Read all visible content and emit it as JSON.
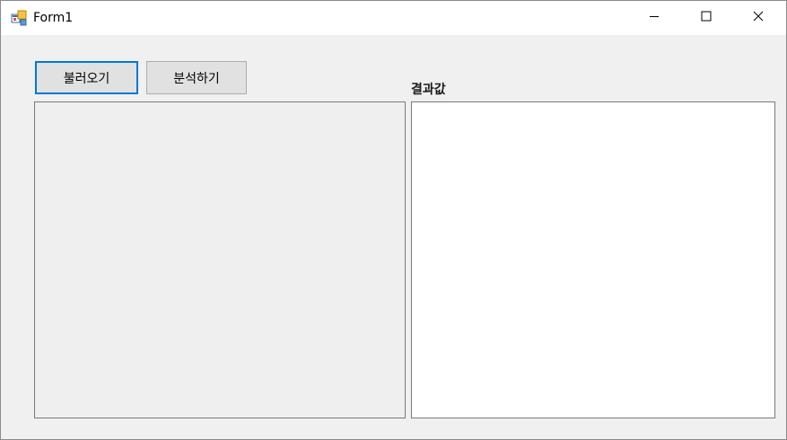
{
  "window": {
    "title": "Form1",
    "controls": {
      "minimize_icon": "minimize-icon",
      "maximize_icon": "maximize-icon",
      "close_icon": "close-icon"
    }
  },
  "toolbar": {
    "load_label": "불러오기",
    "analyze_label": "분석하기"
  },
  "result": {
    "label": "결과값",
    "value": ""
  },
  "colors": {
    "focus_border": "#0078d7",
    "button_bg": "#e1e1e1",
    "form_bg": "#f0f0f0"
  }
}
